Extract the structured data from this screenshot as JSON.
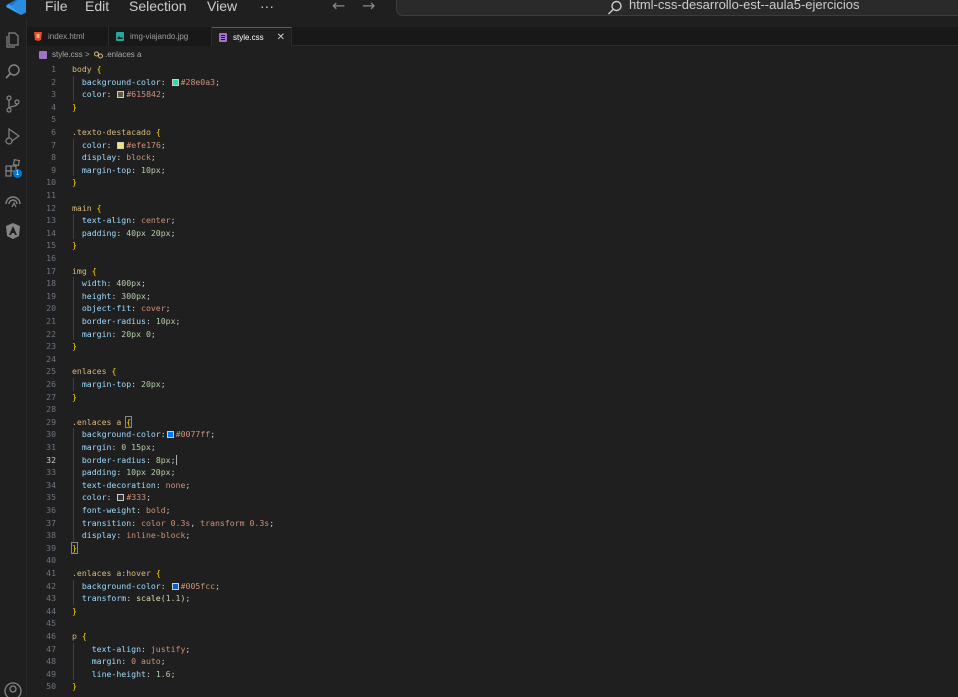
{
  "window": {
    "menu": [
      "File",
      "Edit",
      "Selection",
      "View",
      "···"
    ],
    "search_text": "html-css-desarrollo-est--aula5-ejercicios"
  },
  "activity_bar": {
    "icons": [
      "explorer-icon",
      "search-icon",
      "source-control-icon",
      "run-debug-icon",
      "extensions-icon",
      "remote-explorer-icon",
      "angular-icon",
      "account-icon"
    ],
    "extensions_badge": "1"
  },
  "tabs": [
    {
      "label": "index.html",
      "icon": "html-file-icon",
      "active": false
    },
    {
      "label": "img-viajando.jpg",
      "icon": "image-file-icon",
      "active": false
    },
    {
      "label": "style.css",
      "icon": "css-file-icon",
      "active": true,
      "close": "✕"
    }
  ],
  "breadcrumb": {
    "file": "style.css",
    "separator": ">",
    "symbol": ".enlaces a"
  },
  "editor": {
    "current_line": 32,
    "lines": [
      [
        {
          "t": "body",
          "c": "sel"
        },
        {
          "t": " "
        },
        {
          "t": "{",
          "c": "brace"
        }
      ],
      [
        {
          "t": "  "
        },
        {
          "t": "background-color",
          "c": "prop"
        },
        {
          "t": ": "
        },
        {
          "sw": "#28e0a3"
        },
        {
          "t": "#28e0a3",
          "c": "val"
        },
        {
          "t": ";"
        }
      ],
      [
        {
          "t": "  "
        },
        {
          "t": "color",
          "c": "prop"
        },
        {
          "t": ": "
        },
        {
          "sw": "#615842"
        },
        {
          "t": "#615842",
          "c": "val"
        },
        {
          "t": ";"
        }
      ],
      [
        {
          "t": "}",
          "c": "brace"
        }
      ],
      [],
      [
        {
          "t": ".texto-destacado",
          "c": "sel"
        },
        {
          "t": " "
        },
        {
          "t": "{",
          "c": "brace"
        }
      ],
      [
        {
          "t": "  "
        },
        {
          "t": "color",
          "c": "prop"
        },
        {
          "t": ": "
        },
        {
          "sw": "#efe176"
        },
        {
          "t": "#efe176",
          "c": "val"
        },
        {
          "t": ";"
        }
      ],
      [
        {
          "t": "  "
        },
        {
          "t": "display",
          "c": "prop"
        },
        {
          "t": ": "
        },
        {
          "t": "block",
          "c": "val"
        },
        {
          "t": ";"
        }
      ],
      [
        {
          "t": "  "
        },
        {
          "t": "margin-top",
          "c": "prop"
        },
        {
          "t": ": "
        },
        {
          "t": "10px",
          "c": "num"
        },
        {
          "t": ";"
        }
      ],
      [
        {
          "t": "}",
          "c": "brace"
        }
      ],
      [],
      [
        {
          "t": "main",
          "c": "sel"
        },
        {
          "t": " "
        },
        {
          "t": "{",
          "c": "brace"
        }
      ],
      [
        {
          "t": "  "
        },
        {
          "t": "text-align",
          "c": "prop"
        },
        {
          "t": ": "
        },
        {
          "t": "center",
          "c": "val"
        },
        {
          "t": ";"
        }
      ],
      [
        {
          "t": "  "
        },
        {
          "t": "padding",
          "c": "prop"
        },
        {
          "t": ": "
        },
        {
          "t": "40px 20px",
          "c": "num"
        },
        {
          "t": ";"
        }
      ],
      [
        {
          "t": "}",
          "c": "brace"
        }
      ],
      [],
      [
        {
          "t": "img",
          "c": "sel"
        },
        {
          "t": " "
        },
        {
          "t": "{",
          "c": "brace"
        }
      ],
      [
        {
          "t": "  "
        },
        {
          "t": "width",
          "c": "prop"
        },
        {
          "t": ": "
        },
        {
          "t": "400px",
          "c": "num"
        },
        {
          "t": ";"
        }
      ],
      [
        {
          "t": "  "
        },
        {
          "t": "height",
          "c": "prop"
        },
        {
          "t": ": "
        },
        {
          "t": "300px",
          "c": "num"
        },
        {
          "t": ";"
        }
      ],
      [
        {
          "t": "  "
        },
        {
          "t": "object-fit",
          "c": "prop"
        },
        {
          "t": ": "
        },
        {
          "t": "cover",
          "c": "val"
        },
        {
          "t": ";"
        }
      ],
      [
        {
          "t": "  "
        },
        {
          "t": "border-radius",
          "c": "prop"
        },
        {
          "t": ": "
        },
        {
          "t": "10px",
          "c": "num"
        },
        {
          "t": ";"
        }
      ],
      [
        {
          "t": "  "
        },
        {
          "t": "margin",
          "c": "prop"
        },
        {
          "t": ": "
        },
        {
          "t": "20px 0",
          "c": "num"
        },
        {
          "t": ";"
        }
      ],
      [
        {
          "t": "}",
          "c": "brace"
        }
      ],
      [],
      [
        {
          "t": "enlaces",
          "c": "sel"
        },
        {
          "t": " "
        },
        {
          "t": "{",
          "c": "brace"
        }
      ],
      [
        {
          "t": "  "
        },
        {
          "t": "margin-top",
          "c": "prop"
        },
        {
          "t": ": "
        },
        {
          "t": "20px",
          "c": "num"
        },
        {
          "t": ";"
        }
      ],
      [
        {
          "t": "}",
          "c": "brace"
        }
      ],
      [],
      [
        {
          "t": ".enlaces a",
          "c": "sel"
        },
        {
          "t": " "
        },
        {
          "t": "{",
          "c": "brace",
          "hl": true
        }
      ],
      [
        {
          "t": "  "
        },
        {
          "t": "background-color",
          "c": "prop"
        },
        {
          "t": ":"
        },
        {
          "sw": "#0077ff"
        },
        {
          "t": "#0077ff",
          "c": "val"
        },
        {
          "t": ";"
        }
      ],
      [
        {
          "t": "  "
        },
        {
          "t": "margin",
          "c": "prop"
        },
        {
          "t": ": "
        },
        {
          "t": "0 15px",
          "c": "num"
        },
        {
          "t": ";"
        }
      ],
      [
        {
          "t": "  "
        },
        {
          "t": "border-radius",
          "c": "prop"
        },
        {
          "t": ": "
        },
        {
          "t": "8px",
          "c": "num"
        },
        {
          "t": ";"
        },
        {
          "cursor": true
        }
      ],
      [
        {
          "t": "  "
        },
        {
          "t": "padding",
          "c": "prop"
        },
        {
          "t": ": "
        },
        {
          "t": "10px 20px",
          "c": "num"
        },
        {
          "t": ";"
        }
      ],
      [
        {
          "t": "  "
        },
        {
          "t": "text-decoration",
          "c": "prop"
        },
        {
          "t": ": "
        },
        {
          "t": "none",
          "c": "val"
        },
        {
          "t": ";"
        }
      ],
      [
        {
          "t": "  "
        },
        {
          "t": "color",
          "c": "prop"
        },
        {
          "t": ": "
        },
        {
          "sw": "#333"
        },
        {
          "t": "#333",
          "c": "val"
        },
        {
          "t": ";"
        }
      ],
      [
        {
          "t": "  "
        },
        {
          "t": "font-weight",
          "c": "prop"
        },
        {
          "t": ": "
        },
        {
          "t": "bold",
          "c": "val"
        },
        {
          "t": ";"
        }
      ],
      [
        {
          "t": "  "
        },
        {
          "t": "transition",
          "c": "prop"
        },
        {
          "t": ": "
        },
        {
          "t": "color 0.3s",
          "c": "val"
        },
        {
          "t": ", "
        },
        {
          "t": "transform 0.3s",
          "c": "val"
        },
        {
          "t": ";"
        }
      ],
      [
        {
          "t": "  "
        },
        {
          "t": "display",
          "c": "prop"
        },
        {
          "t": ": "
        },
        {
          "t": "inline-block",
          "c": "val"
        },
        {
          "t": ";"
        }
      ],
      [
        {
          "t": "}",
          "c": "brace",
          "hl": true
        }
      ],
      [],
      [
        {
          "t": ".enlaces a:hover",
          "c": "sel"
        },
        {
          "t": " "
        },
        {
          "t": "{",
          "c": "brace"
        }
      ],
      [
        {
          "t": "  "
        },
        {
          "t": "background-color",
          "c": "prop"
        },
        {
          "t": ": "
        },
        {
          "sw": "#005fcc"
        },
        {
          "t": "#005fcc",
          "c": "val"
        },
        {
          "t": ";"
        }
      ],
      [
        {
          "t": "  "
        },
        {
          "t": "transform",
          "c": "prop"
        },
        {
          "t": ": "
        },
        {
          "t": "scale",
          "c": "fn"
        },
        {
          "t": "("
        },
        {
          "t": "1.1",
          "c": "num"
        },
        {
          "t": ");"
        }
      ],
      [
        {
          "t": "}",
          "c": "brace"
        }
      ],
      [],
      [
        {
          "t": "p",
          "c": "sel"
        },
        {
          "t": " "
        },
        {
          "t": "{",
          "c": "brace"
        }
      ],
      [
        {
          "t": "    "
        },
        {
          "t": "text-align",
          "c": "prop"
        },
        {
          "t": ": "
        },
        {
          "t": "justify",
          "c": "val"
        },
        {
          "t": ";"
        }
      ],
      [
        {
          "t": "    "
        },
        {
          "t": "margin",
          "c": "prop"
        },
        {
          "t": ": "
        },
        {
          "t": "0 auto",
          "c": "val"
        },
        {
          "t": ";"
        }
      ],
      [
        {
          "t": "    "
        },
        {
          "t": "line-height",
          "c": "prop"
        },
        {
          "t": ": "
        },
        {
          "t": "1.6",
          "c": "num"
        },
        {
          "t": ";"
        }
      ],
      [
        {
          "t": "}",
          "c": "brace"
        }
      ]
    ]
  }
}
